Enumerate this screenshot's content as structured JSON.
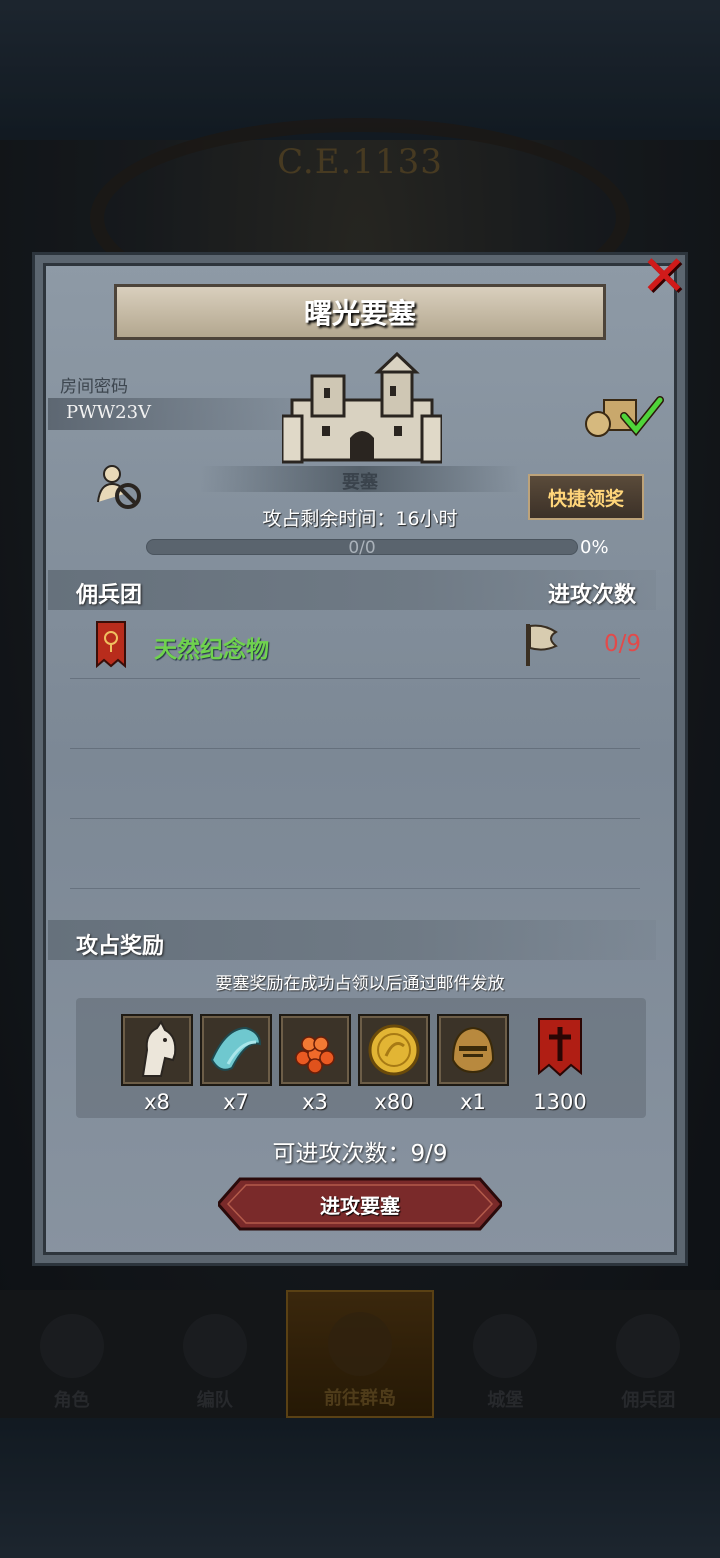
{
  "background": {
    "era_label": "C.E.1133"
  },
  "dialog": {
    "title": "曙光要塞",
    "room": {
      "label": "房间密码",
      "code": "PWW23V"
    },
    "fortress_label": "要塞",
    "quick_claim_label": "快捷领奖",
    "remaining_time": "攻占剩余时间：16小时",
    "progress": {
      "text": "0/0",
      "percent_text": "0%",
      "fraction": 0
    },
    "mercenary_section": {
      "title": "佣兵团",
      "attack_count_header": "进攻次数",
      "rows": [
        {
          "guild_name": "天然纪念物",
          "attacks": "0/9"
        }
      ]
    },
    "rewards_section": {
      "title": "攻占奖励",
      "note": "要塞奖励在成功占领以后通过邮件发放",
      "items": [
        {
          "icon": "horse-icon",
          "qty": "x8"
        },
        {
          "icon": "cloth-icon",
          "qty": "x7"
        },
        {
          "icon": "caviar-icon",
          "qty": "x3"
        },
        {
          "icon": "gold-coin-icon",
          "qty": "x80"
        },
        {
          "icon": "helmet-icon",
          "qty": "x1"
        },
        {
          "icon": "guild-banner-icon",
          "qty": "1300"
        }
      ]
    },
    "available_attacks": "可进攻次数：9/9",
    "attack_button_label": "进攻要塞"
  },
  "bottom_nav": {
    "items": [
      {
        "label": "角色",
        "icon": "knight-icon",
        "active": false
      },
      {
        "label": "编队",
        "icon": "team-icon",
        "active": false
      },
      {
        "label": "前往群岛",
        "icon": "compass-icon",
        "active": true
      },
      {
        "label": "城堡",
        "icon": "castle-icon",
        "active": false
      },
      {
        "label": "佣兵团",
        "icon": "mercenary-icon",
        "active": false
      }
    ]
  },
  "colors": {
    "close": "#d01a1a",
    "guild_name": "#6fd24e",
    "attack_count": "#e24a4a",
    "quick_claim_text": "#ffd57a",
    "attack_button": "#7a2a2a"
  }
}
